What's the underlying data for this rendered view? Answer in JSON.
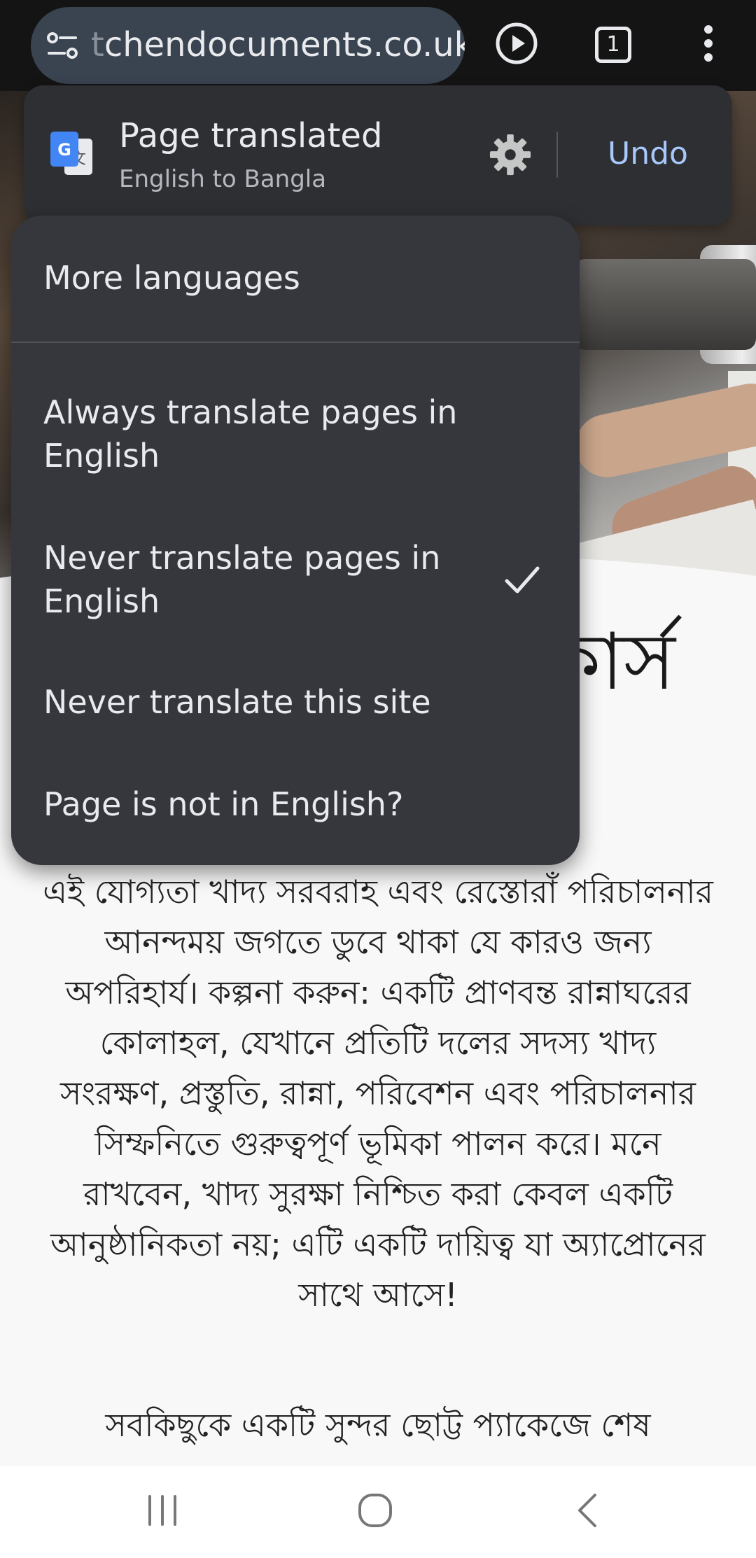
{
  "browser": {
    "url_prefix": "t",
    "url": "chendocuments.co.uk",
    "tab_count": "1",
    "icons": [
      "site-settings-icon",
      "play-icon",
      "tab-switcher-icon",
      "more-vert-icon"
    ]
  },
  "translate_bar": {
    "title": "Page translated",
    "subtitle": "English to Bangla",
    "undo_label": "Undo",
    "icons": [
      "google-translate-icon",
      "gear-icon"
    ],
    "accent": "#a8c7fa"
  },
  "menu": {
    "items": [
      {
        "label": "More languages",
        "checked": false
      },
      {
        "label": "Always translate pages in English",
        "checked": false
      },
      {
        "label": "Never translate pages in English",
        "checked": true
      },
      {
        "label": "Never translate this site",
        "checked": false
      },
      {
        "label": "Page is not in English?",
        "checked": false
      }
    ]
  },
  "page": {
    "heading_fragment": "কার্স",
    "paragraph1": "এই যোগ্যতা খাদ্য সরবরাহ এবং রেস্তোরাঁ পরিচালনার আনন্দময় জগতে ডুবে থাকা যে কারও জন্য অপরিহার্য। কল্পনা করুন: একটি প্রাণবন্ত রান্নাঘরের কোলাহল, যেখানে প্রতিটি দলের সদস্য খাদ্য সংরক্ষণ, প্রস্তুতি, রান্না, পরিবেশন এবং পরিচালনার সিম্ফনিতে গুরুত্বপূর্ণ ভূমিকা পালন করে। মনে রাখবেন, খাদ্য সুরক্ষা নিশ্চিত করা কেবল একটি আনুষ্ঠানিকতা নয়; এটি একটি দায়িত্ব যা অ্যাপ্রোনের সাথে আসে!",
    "paragraph2": "সবকিছুকে একটি সুন্দর ছোট্ট প্যাকেজে শেষ"
  },
  "navbar": {
    "icons": [
      "recent-apps-icon",
      "home-icon",
      "back-icon"
    ]
  }
}
